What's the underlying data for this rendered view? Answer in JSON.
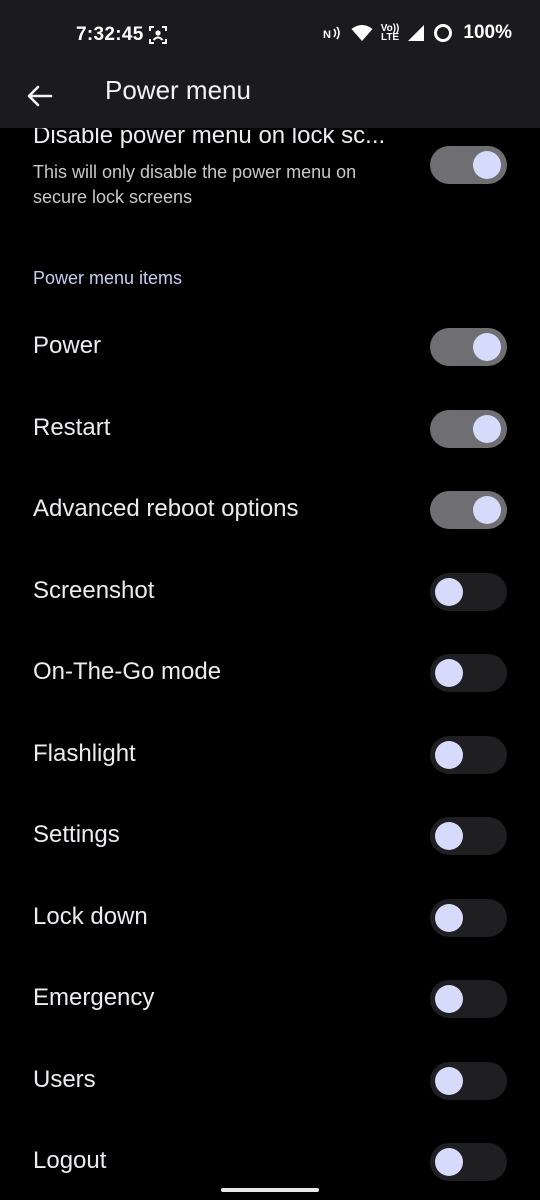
{
  "status_bar": {
    "time": "7:32:45",
    "battery_percent": "100%",
    "network_type": "LTE",
    "icons": [
      "screen-record-icon",
      "nfc-icon",
      "wifi-icon",
      "volte-icon",
      "signal-icon",
      "battery-icon"
    ]
  },
  "app_bar": {
    "back_icon": "arrow-back-icon",
    "title": "Power menu"
  },
  "lock_screen_item": {
    "title": "Disable power menu on lock sc...",
    "summary": "This will only disable the power menu on secure lock screens",
    "enabled": true
  },
  "section": {
    "header": "Power menu items"
  },
  "items": [
    {
      "label": "Power",
      "enabled": true
    },
    {
      "label": "Restart",
      "enabled": true
    },
    {
      "label": "Advanced reboot options",
      "enabled": true
    },
    {
      "label": "Screenshot",
      "enabled": false
    },
    {
      "label": "On-The-Go mode",
      "enabled": false
    },
    {
      "label": "Flashlight",
      "enabled": false
    },
    {
      "label": "Settings",
      "enabled": false
    },
    {
      "label": "Lock down",
      "enabled": false
    },
    {
      "label": "Emergency",
      "enabled": false
    },
    {
      "label": "Users",
      "enabled": false
    },
    {
      "label": "Logout",
      "enabled": false
    }
  ],
  "colors": {
    "background": "#000000",
    "app_bar": "#1b1b1e",
    "accent_header": "#c9cdf2",
    "toggle_thumb": "#d7dbfb",
    "toggle_track_on": "#6f6f73",
    "toggle_track_off": "#1f1f22"
  }
}
